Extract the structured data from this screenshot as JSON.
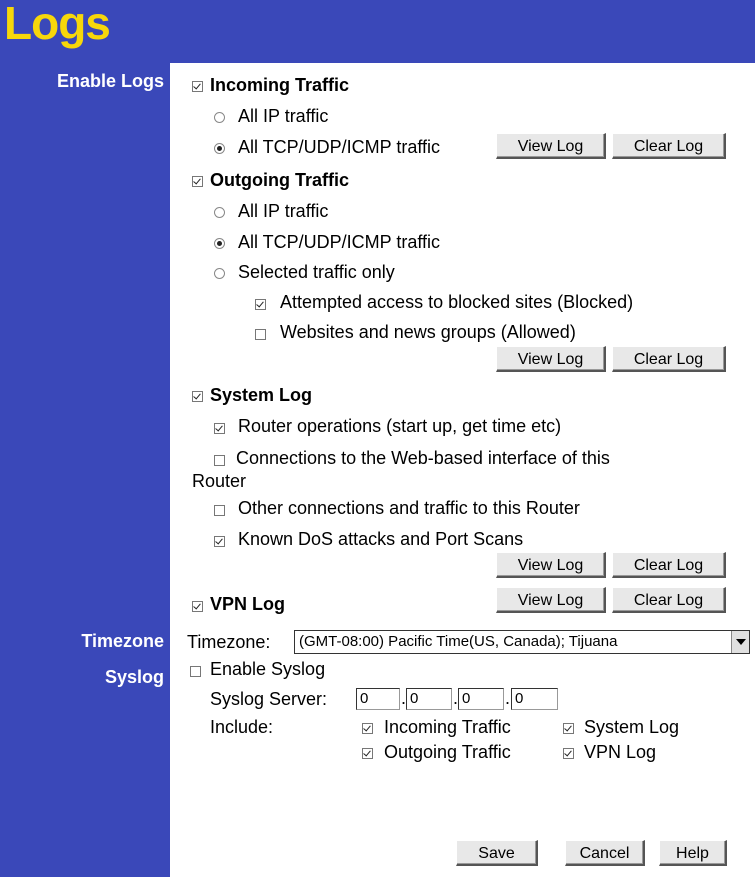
{
  "page": {
    "title": "Logs"
  },
  "sections": {
    "enable_logs": "Enable Logs",
    "timezone": "Timezone",
    "syslog": "Syslog"
  },
  "incoming": {
    "label": "Incoming Traffic",
    "checked": true,
    "opt_all_ip": "All IP traffic",
    "opt_tcp": "All TCP/UDP/ICMP traffic",
    "selected_option": "All TCP/UDP/ICMP traffic"
  },
  "outgoing": {
    "label": "Outgoing Traffic",
    "checked": true,
    "opt_all_ip": "All IP traffic",
    "opt_tcp": "All TCP/UDP/ICMP traffic",
    "opt_selected": "Selected traffic only",
    "selected_option": "All TCP/UDP/ICMP traffic",
    "blocked_sites": "Attempted access to blocked sites (Blocked)",
    "websites_news": "Websites and news groups (Allowed)"
  },
  "system_log": {
    "label": "System Log",
    "checked": true,
    "router_ops": "Router operations (start up, get time etc)",
    "web_conn_line1": "Connections to the Web-based interface of this",
    "web_conn_line2": "Router",
    "other_conn": "Other connections and traffic to this Router",
    "dos": "Known DoS attacks and Port Scans"
  },
  "vpn_log": {
    "label": "VPN Log",
    "checked": true
  },
  "buttons": {
    "view_log": "View Log",
    "clear_log": "Clear Log",
    "save": "Save",
    "cancel": "Cancel",
    "help": "Help"
  },
  "timezone": {
    "label": "Timezone:",
    "selected": "(GMT-08:00) Pacific Time(US, Canada); Tijuana"
  },
  "syslog": {
    "enable_label": "Enable Syslog",
    "enabled": false,
    "server_label": "Syslog Server:",
    "server_octets": [
      "0",
      "0",
      "0",
      "0"
    ],
    "include_label": "Include:",
    "inc_incoming": "Incoming Traffic",
    "inc_system": "System Log",
    "inc_outgoing": "Outgoing Traffic",
    "inc_vpn": "VPN Log"
  }
}
